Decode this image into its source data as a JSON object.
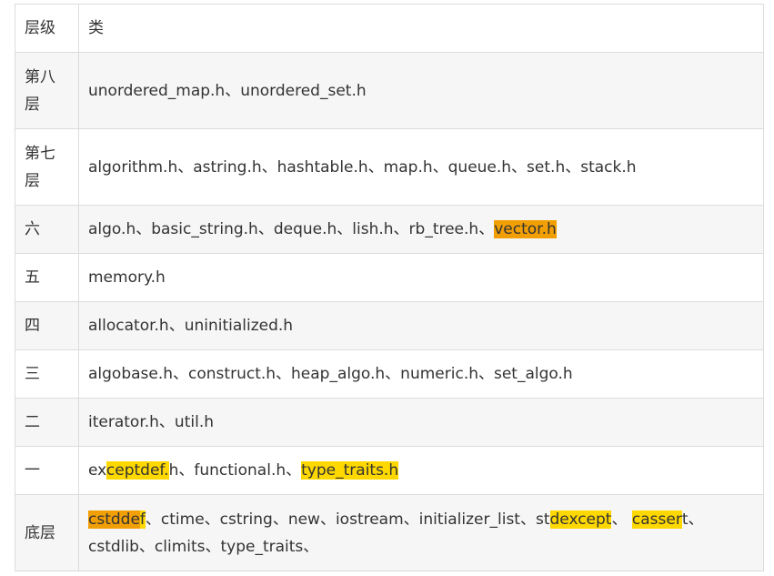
{
  "table": {
    "header": [
      "层级",
      "类"
    ],
    "rows": [
      {
        "level": "第八层",
        "segments": [
          {
            "text": "unordered_map.h、unordered_set.h"
          }
        ]
      },
      {
        "level": "第七层",
        "segments": [
          {
            "text": "algorithm.h、astring.h、hashtable.h、map.h、queue.h、set.h、stack.h"
          }
        ]
      },
      {
        "level": "六",
        "segments": [
          {
            "text": "algo.h、basic_string.h、deque.h、lish.h、rb_tree.h、"
          },
          {
            "text": "vector.h",
            "highlight": "#f29f05"
          }
        ]
      },
      {
        "level": "五",
        "segments": [
          {
            "text": "memory.h"
          }
        ]
      },
      {
        "level": "四",
        "segments": [
          {
            "text": "allocator.h、uninitialized.h"
          }
        ]
      },
      {
        "level": "三",
        "segments": [
          {
            "text": "algobase.h、construct.h、heap_algo.h、numeric.h、set_algo.h"
          }
        ]
      },
      {
        "level": "二",
        "segments": [
          {
            "text": "iterator.h、util.h"
          }
        ]
      },
      {
        "level": "一",
        "segments": [
          {
            "text": "ex"
          },
          {
            "text": "ceptdef.",
            "highlight": "#ffd800"
          },
          {
            "text": "h、functional.h、"
          },
          {
            "text": "type_traits.h",
            "highlight": "#ffd800"
          }
        ]
      },
      {
        "level": "底层",
        "segments": [
          {
            "text": "cstdde",
            "highlight": "#f29f05"
          },
          {
            "text": "f",
            "highlight": "#ffd800"
          },
          {
            "text": "、ctime、cstring、new、iostream、initializer_list、st"
          },
          {
            "text": "dexcept",
            "highlight": "#ffd800"
          },
          {
            "text": "、 "
          },
          {
            "text": "casser",
            "highlight": "#ffd800"
          },
          {
            "text": "t、\ncstdlib、climits、type_traits、"
          }
        ]
      }
    ]
  },
  "colors": {
    "border": "#dcdcdc",
    "alt_row": "#f6f6f6",
    "text": "#333333",
    "highlight_orange": "#f29f05",
    "highlight_yellow": "#ffd800"
  }
}
